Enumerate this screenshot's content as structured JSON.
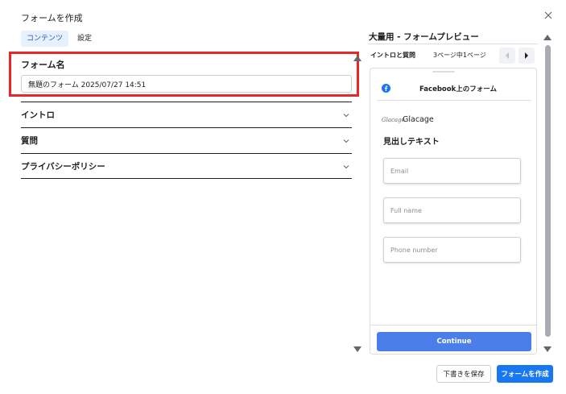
{
  "dialog": {
    "title": "フォームを作成",
    "close_icon": "close-icon"
  },
  "tabs": [
    {
      "label": "コンテンツ",
      "active": true
    },
    {
      "label": "設定",
      "active": false
    }
  ],
  "form_name": {
    "label": "フォーム名",
    "value": "無題のフォーム 2025/07/27 14:51"
  },
  "sections": [
    {
      "label": "イントロ",
      "icon": "chevron-down-icon"
    },
    {
      "label": "質問",
      "icon": "chevron-down-icon"
    },
    {
      "label": "プライバシーポリシー",
      "icon": "chevron-down-icon"
    }
  ],
  "preview": {
    "title": "大量用 - フォームプレビュー",
    "step_label": "イントロと質問",
    "page_indicator": "3ページ中1ページ",
    "card": {
      "header_title": "Facebook上のフォーム",
      "header_icon": "facebook-icon",
      "brand_logo": "Glacage",
      "brand_name": "Glacage",
      "headline": "見出しテキスト",
      "fields": [
        {
          "placeholder": "Email"
        },
        {
          "placeholder": "Full name"
        },
        {
          "placeholder": "Phone number"
        }
      ],
      "continue_label": "Continue"
    }
  },
  "footer": {
    "save_draft_label": "下書きを保存",
    "create_label": "フォームを作成"
  },
  "colors": {
    "highlight": "#e6282b",
    "primary": "#1877f2",
    "continue": "#4b7ee8",
    "tab_active_bg": "#e7f0fd"
  }
}
